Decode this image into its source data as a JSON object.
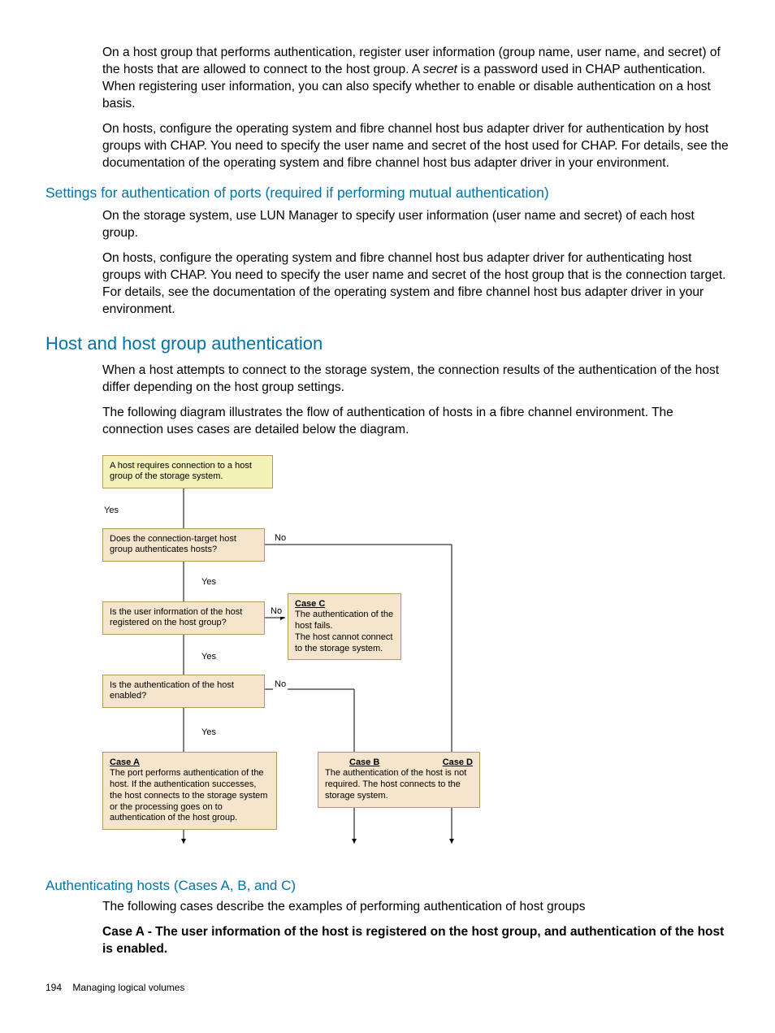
{
  "para1a": "On a host group that performs authentication, register user information (group name, user name, and secret) of the hosts that are allowed to connect to the host group. A ",
  "para1_secret": "secret",
  "para1b": " is a password used in CHAP authentication. When registering user information, you can also specify whether to enable or disable authentication on a host basis.",
  "para2": "On hosts, configure the operating system and fibre channel host bus adapter driver for authentication by host groups with CHAP. You need to specify the user name and secret of the host used for CHAP. For details, see the documentation of the operating system and fibre channel host bus adapter driver in your environment.",
  "h_settings": "Settings for authentication of ports (required if performing mutual authentication)",
  "para3": "On the storage system, use LUN Manager to specify user information (user name and secret) of each host group.",
  "para4": "On hosts, configure the operating system and fibre channel host bus adapter driver for authenticating host groups with CHAP. You need to specify the user name and secret of the host group that is the connection target. For details, see the documentation of the operating system and fibre channel host bus adapter driver in your environment.",
  "h_hosthost": "Host and host group authentication",
  "para5": "When a host attempts to connect to the storage system, the connection results of the authentication of the host differ depending on the host group settings.",
  "para6": "The following diagram illustrates the flow of authentication of hosts in a fibre channel environment. The connection uses cases are detailed below the diagram.",
  "diagram": {
    "start": "A host requires connection to a host group of the storage system.",
    "q1": "Does the connection-target host group authenticates hosts?",
    "q2": "Is the user information of the host registered on the host group?",
    "q3": "Is the authentication of the host enabled?",
    "yes": "Yes",
    "no": "No",
    "caseA_t": "Case A",
    "caseA": "The port performs authentication of the host. If the authentication successes, the host connects to the storage system or the processing goes on to authentication of the host group.",
    "caseB_t": "Case B",
    "caseB": "The authentication of the host is not required. The host connects to the storage system.",
    "caseC_t": "Case C",
    "caseC": "The authentication of the host fails.\nThe host cannot connect to the storage system.",
    "caseD_t": "Case D"
  },
  "h_auth": "Authenticating hosts (Cases A, B, and C)",
  "para7": "The following cases describe the examples of performing authentication of host groups",
  "para8": "Case A - The user information of the host is registered on the host group, and authentication of the host is enabled.",
  "footer_page": "194",
  "footer_title": "Managing logical volumes"
}
